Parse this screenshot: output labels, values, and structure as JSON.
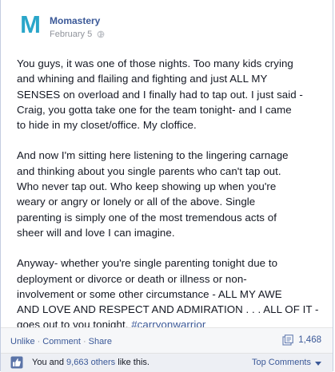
{
  "post": {
    "page_name": "Momastery",
    "date": "February 5",
    "avatar_letter": "M",
    "paragraphs": [
      "You guys, it was one of those nights. Too many kids crying\nand whining and flailing and fighting and just ALL MY\nSENSES on overload and I finally had to tap out. I just said -\nCraig, you gotta take one for the team tonight- and I came\nto hide in my closet/office. My cloffice.",
      "And now I'm sitting here listening to the lingering carnage\nand thinking about you single parents who can't tap out.\nWho never tap out. Who keep showing up when you're\nweary or angry or lonely or all of the above. Single\nparenting is simply one of the most tremendous acts of\nsheer will and love I can imagine.",
      "Anyway- whether you're single parenting tonight due to\ndeployment or divorce or death or illness or non-\ninvolvement or some other circumstance - ALL MY AWE\nAND LOVE AND RESPECT AND ADMIRATION . . . ALL OF IT -\ngoes out to you tonight. "
    ],
    "hashtag": "#carryonwarrior"
  },
  "actions": {
    "unlike": "Unlike",
    "comment": "Comment",
    "share": "Share",
    "separator": "·",
    "share_count": "1,468"
  },
  "likes": {
    "prefix": "You and ",
    "others_link": "9,663 others",
    "suffix": " like this.",
    "sort_label": "Top Comments"
  },
  "colors": {
    "link": "#3b5998",
    "avatar": "#2aa6c9"
  },
  "icons": {
    "privacy": "globe-icon",
    "share": "share-icon",
    "like": "thumbs-up-icon",
    "sort": "caret-down-icon"
  }
}
